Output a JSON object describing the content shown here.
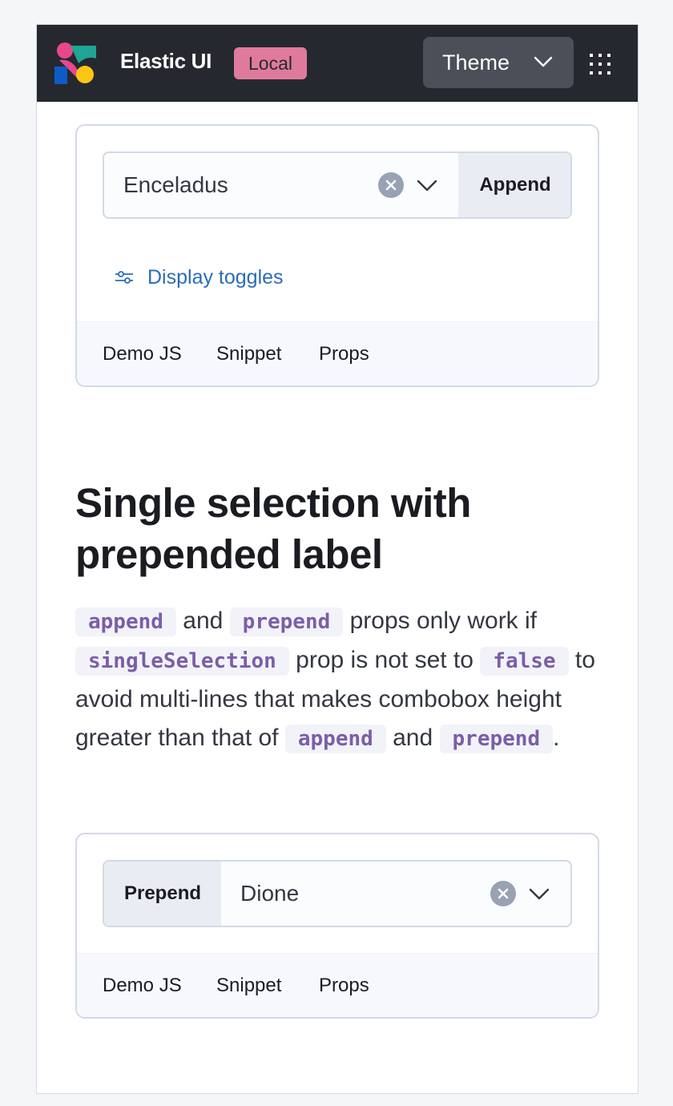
{
  "header": {
    "app_title": "Elastic UI",
    "env_badge": "Local",
    "theme_button": "Theme",
    "logo_icon": "elastic-logo-icon",
    "apps_icon": "apps-grid-icon"
  },
  "example1": {
    "combo_value": "Enceladus",
    "append_label": "Append",
    "display_toggles": "Display toggles",
    "tabs": [
      "Demo JS",
      "Snippet",
      "Props"
    ]
  },
  "section": {
    "title": "Single selection with prepended label",
    "description": {
      "code_append": "append",
      "and1": "and",
      "code_prepend": "prepend",
      "text1": "props only work if",
      "code_single": "singleSelection",
      "text2": "prop is not set to",
      "code_false": "false",
      "text3": "to avoid multi-lines that makes combobox height greater than that of",
      "code_append2": "append",
      "and2": "and",
      "code_prepend2": "prepend",
      "period": "."
    }
  },
  "example2": {
    "prepend_label": "Prepend",
    "combo_value": "Dione",
    "tabs": [
      "Demo JS",
      "Snippet",
      "Props"
    ]
  },
  "colors": {
    "header_bg": "#25282f",
    "badge_bg": "#e07a9c",
    "link": "#2b6cb8",
    "code": "#7b5ea7"
  }
}
